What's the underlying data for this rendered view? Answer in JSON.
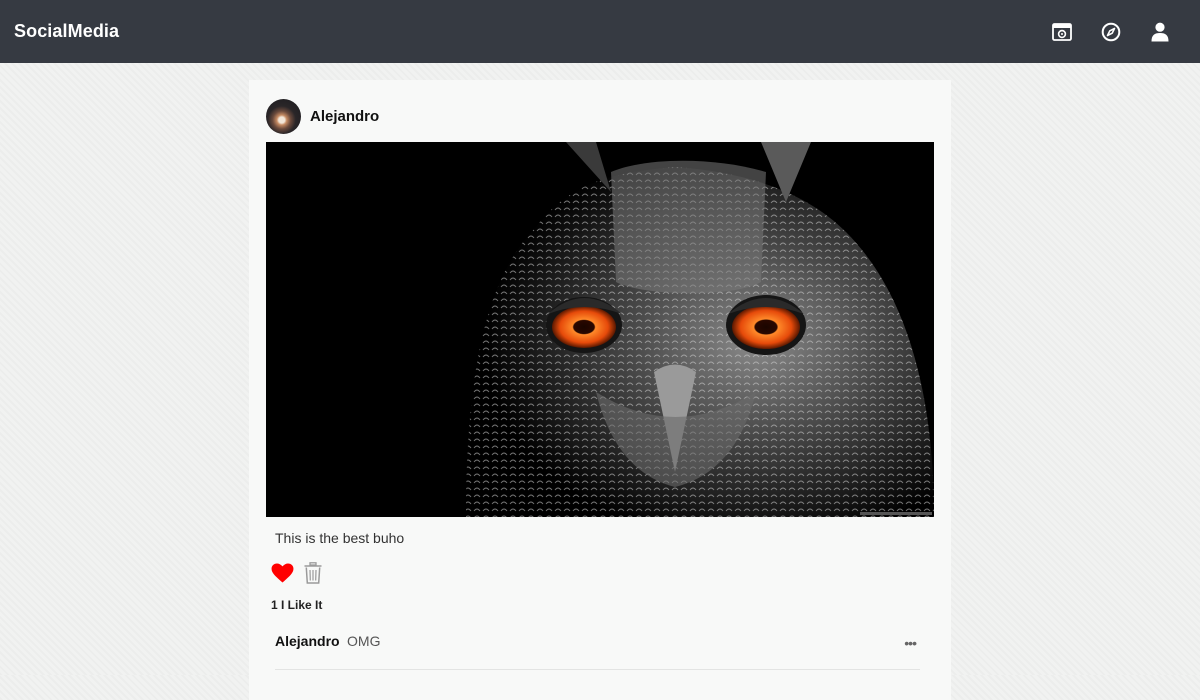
{
  "app": {
    "brand": "SocialMedia"
  },
  "nav": {
    "icons": [
      "photo-upload-icon",
      "compass-explore-icon",
      "user-profile-icon"
    ],
    "icon_color": "#ffffff",
    "bar_color": "#363a42"
  },
  "post": {
    "author": "Alejandro",
    "caption": "This is the best buho",
    "likes_text": "1 I Like It",
    "liked": true,
    "heart_color": "#ff0000",
    "comments": [
      {
        "author": "Alejandro",
        "text": "OMG",
        "more": "•••"
      }
    ]
  }
}
